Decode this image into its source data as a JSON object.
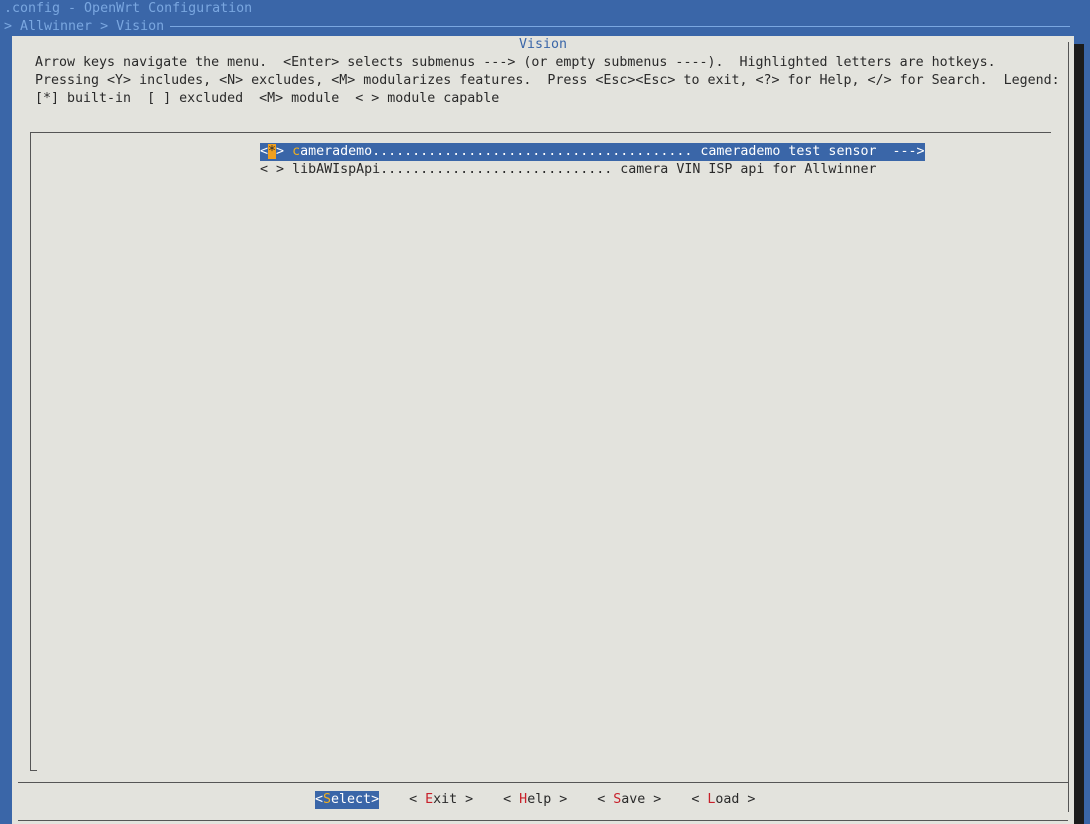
{
  "terminal": {
    "title_line": ".config - OpenWrt Configuration",
    "breadcrumb": "> Allwinner > Vision"
  },
  "dialog": {
    "title": "Vision",
    "help": [
      "Arrow keys navigate the menu.  <Enter> selects submenus ---> (or empty submenus ----).  Highlighted letters are hotkeys.",
      "Pressing <Y> includes, <N> excludes, <M> modularizes features.  Press <Esc><Esc> to exit, <?> for Help, </> for Search.  Legend:",
      "[*] built-in  [ ] excluded  <M> module  < > module capable"
    ]
  },
  "menu": {
    "items": [
      {
        "mark_open": "<",
        "mark_value": "*",
        "mark_close": ">",
        "hotkey": "c",
        "rest": "amerademo........................................ camerademo test sensor  --->",
        "selected": true
      },
      {
        "mark_open": "<",
        "mark_value": " ",
        "mark_close": ">",
        "hotkey": "",
        "rest": "libAWIspApi............................. camera VIN ISP api for Allwinner",
        "selected": false
      }
    ]
  },
  "buttons": [
    {
      "open": "<",
      "hotkey": "S",
      "rest": "elect",
      "close": ">",
      "active": true
    },
    {
      "open": "< ",
      "hotkey": "E",
      "rest": "xit",
      "close": " >",
      "active": false
    },
    {
      "open": "< ",
      "hotkey": "H",
      "rest": "elp",
      "close": " >",
      "active": false
    },
    {
      "open": "< ",
      "hotkey": "S",
      "rest": "ave",
      "close": " >",
      "active": false
    },
    {
      "open": "< ",
      "hotkey": "L",
      "rest": "oad",
      "close": " >",
      "active": false
    }
  ],
  "colors": {
    "terminal_bg": "#3a66a8",
    "dialog_bg": "#e3e3dd",
    "highlight_bg": "#3a66a8",
    "hotkey": "#c8202a",
    "selected_mark": "#f0a020"
  }
}
